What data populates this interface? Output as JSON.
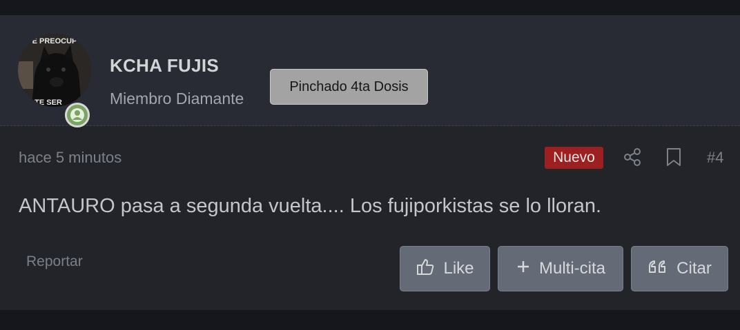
{
  "colors": {
    "page_background": "#15171c",
    "post_background": "#222429",
    "user_block_background": "#282b33",
    "new_badge": "#9e1f1f",
    "online_badge": "#7ba361",
    "button_background": "#646b77",
    "banner_background": "#a3a3a3"
  },
  "user": {
    "name": "KCHA FUJIS",
    "title": "Miembro Diamante",
    "banner": "Pinchado 4ta Dosis",
    "avatar_text_top": "E PREOCUP",
    "avatar_text_bottom": "TE SER",
    "status_icon": "user-online-icon"
  },
  "meta": {
    "time": "hace 5 minutos",
    "new_badge": "Nuevo",
    "share_icon": "share-icon",
    "bookmark_icon": "bookmark-icon",
    "post_number": "#4"
  },
  "message": {
    "text": "ANTAURO pasa a segunda vuelta.... Los fujiporkistas se lo lloran."
  },
  "actions": {
    "report_label": "Reportar",
    "like_label": "Like",
    "like_icon": "thumbs-up-icon",
    "multiquote_label": "Multi-cita",
    "multiquote_icon": "plus-icon",
    "quote_label": "Citar",
    "quote_icon": "quote-icon"
  }
}
